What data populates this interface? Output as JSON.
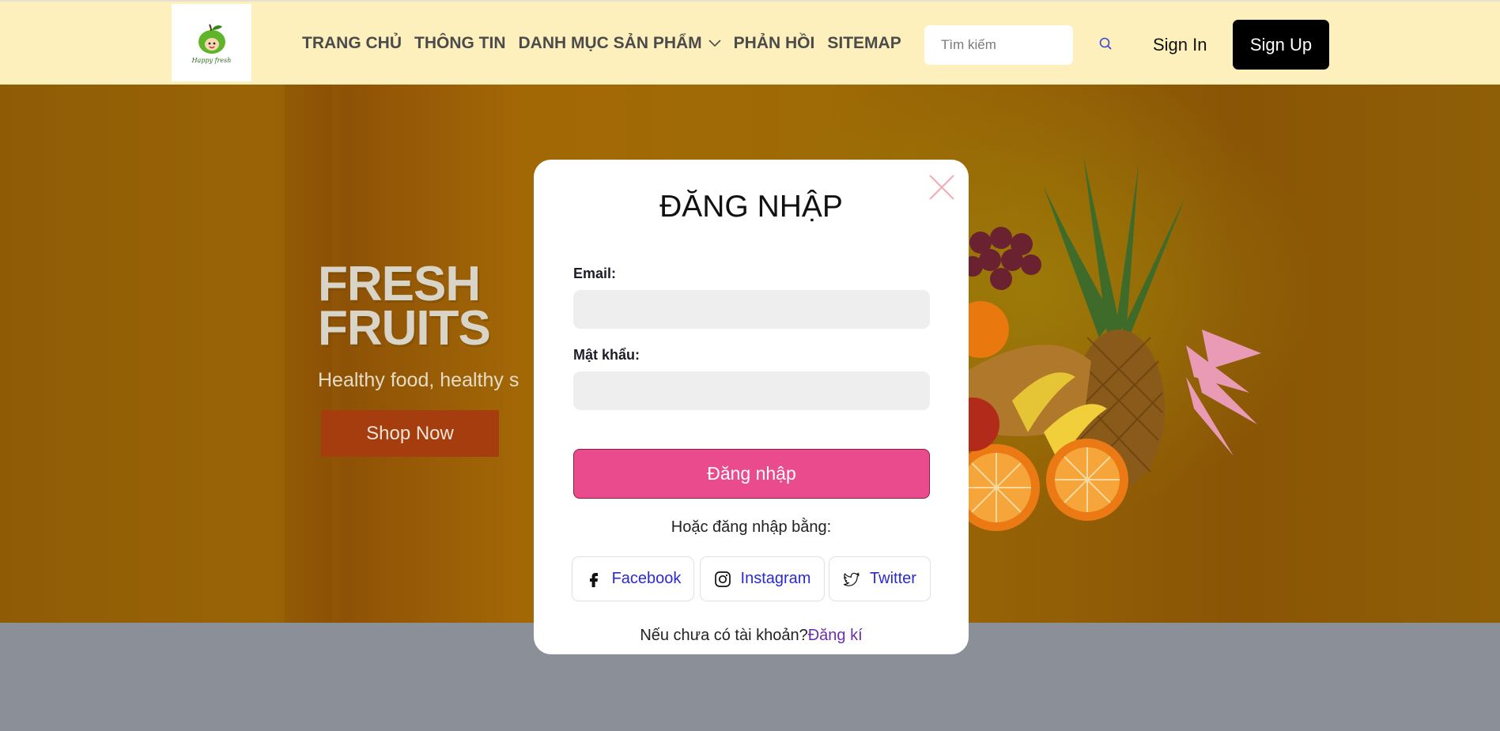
{
  "header": {
    "logo_text": "Happy fresh",
    "nav": [
      {
        "label": "TRANG CHỦ"
      },
      {
        "label": "THÔNG TIN"
      },
      {
        "label": "DANH MỤC SẢN PHẨM",
        "has_dropdown": true
      },
      {
        "label": "PHẢN HỒI"
      },
      {
        "label": "SITEMAP"
      }
    ],
    "search_placeholder": "Tìm kiếm",
    "signin_label": "Sign In",
    "signup_label": "Sign Up"
  },
  "hero": {
    "title_line1": "FRESH",
    "title_line2": "FRUITS",
    "tagline": "Healthy food, healthy s",
    "cta_label": "Shop Now"
  },
  "modal": {
    "title": "ĐĂNG NHẬP",
    "email_label": "Email:",
    "email_value": "",
    "password_label": "Mật khẩu:",
    "password_value": "",
    "submit_label": "Đăng nhập",
    "alt_login_text": "Hoặc đăng nhập bằng:",
    "social": [
      {
        "label": "Facebook",
        "icon": "facebook-icon"
      },
      {
        "label": "Instagram",
        "icon": "instagram-icon"
      },
      {
        "label": "Twitter",
        "icon": "twitter-icon"
      }
    ],
    "register_prompt": "Nếu chưa có tài khoản?",
    "register_link": "Đăng kí"
  },
  "colors": {
    "header_bg": "#fdf0bc",
    "primary_button": "#e94b8c",
    "signup_bg": "#000000",
    "link": "#2a2ad0",
    "register_link": "#6b2ea8",
    "page_bg": "#8a8f98"
  }
}
